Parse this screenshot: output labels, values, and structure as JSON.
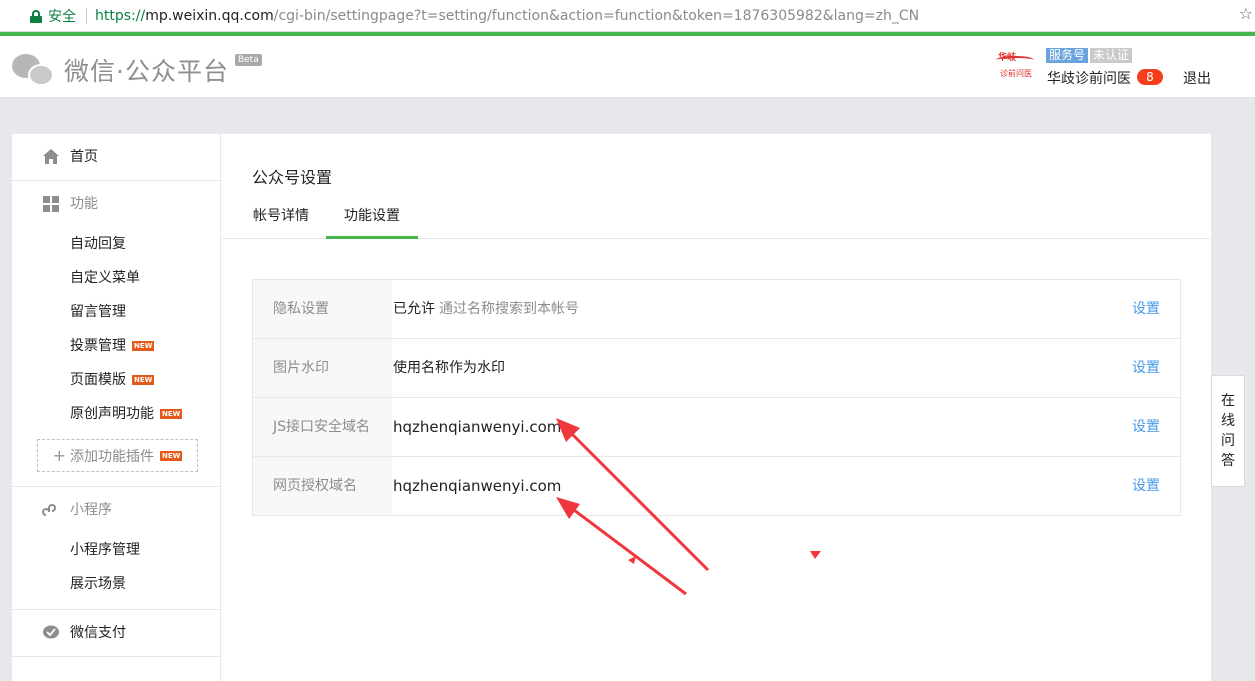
{
  "browser": {
    "secure_label": "安全",
    "url_scheme": "https://",
    "url_host": "mp.weixin.qq.com",
    "url_path": "/cgi-bin/settingpage?t=setting/function&action=function&token=1876305982&lang=zh_CN"
  },
  "header": {
    "logo_text": "微信·公众平台",
    "beta": "Beta",
    "avatar_line1": "华岐",
    "avatar_line2": "诊前问医",
    "tag_service": "服务号",
    "tag_unverified": "未认证",
    "account_name": "华歧诊前问医",
    "message_count": "8",
    "logout": "退出"
  },
  "sidebar": {
    "home": "首页",
    "function_title": "功能",
    "function_items": [
      {
        "label": "自动回复"
      },
      {
        "label": "自定义菜单"
      },
      {
        "label": "留言管理"
      },
      {
        "label": "投票管理",
        "new": "NEW"
      },
      {
        "label": "页面模版",
        "new": "NEW"
      },
      {
        "label": "原创声明功能",
        "new": "NEW"
      }
    ],
    "add_plugin": "添加功能插件",
    "add_plugin_new": "NEW",
    "miniprogram_title": "小程序",
    "miniprogram_items": [
      {
        "label": "小程序管理"
      },
      {
        "label": "展示场景"
      }
    ],
    "wechat_pay": "微信支付"
  },
  "main": {
    "title": "公众号设置",
    "tabs": [
      {
        "label": "帐号详情"
      },
      {
        "label": "功能设置"
      }
    ],
    "rows": [
      {
        "label": "隐私设置",
        "value": "已允许",
        "desc": "通过名称搜索到本帐号",
        "action": "设置"
      },
      {
        "label": "图片水印",
        "value": "使用名称作为水印",
        "desc": "",
        "action": "设置"
      },
      {
        "label": "JS接口安全域名",
        "value": "hqzhenqianwenyi.com",
        "desc": "",
        "action": "设置"
      },
      {
        "label": "网页授权域名",
        "value": "hqzhenqianwenyi.com",
        "desc": "",
        "action": "设置"
      }
    ]
  },
  "float_qa": [
    "在",
    "线",
    "问",
    "答"
  ],
  "colors": {
    "brand_green": "#44b549",
    "link_blue": "#459ae9",
    "badge_red": "#f43f1d",
    "annotation_red": "#f0373b"
  }
}
